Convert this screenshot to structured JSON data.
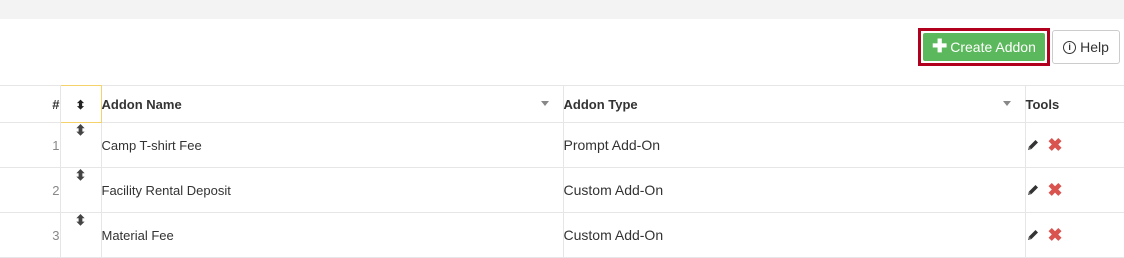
{
  "toolbar": {
    "create_label": "Create Addon",
    "help_label": "Help"
  },
  "table": {
    "headers": {
      "num": "#",
      "name": "Addon Name",
      "type": "Addon Type",
      "tools": "Tools"
    },
    "rows": [
      {
        "num": "1",
        "name": "Camp T-shirt Fee",
        "type": "Prompt Add-On"
      },
      {
        "num": "2",
        "name": "Facility Rental Deposit",
        "type": "Custom Add-On"
      },
      {
        "num": "3",
        "name": "Material Fee",
        "type": "Custom Add-On"
      }
    ]
  },
  "colors": {
    "create_button": "#5cb85c",
    "highlight_border": "#b0001e",
    "delete_icon": "#d9534f"
  },
  "icons": {
    "create": "plus-icon",
    "help": "info-icon",
    "sort": "up-down-arrows-icon",
    "edit": "pencil-icon",
    "delete": "x-icon"
  }
}
